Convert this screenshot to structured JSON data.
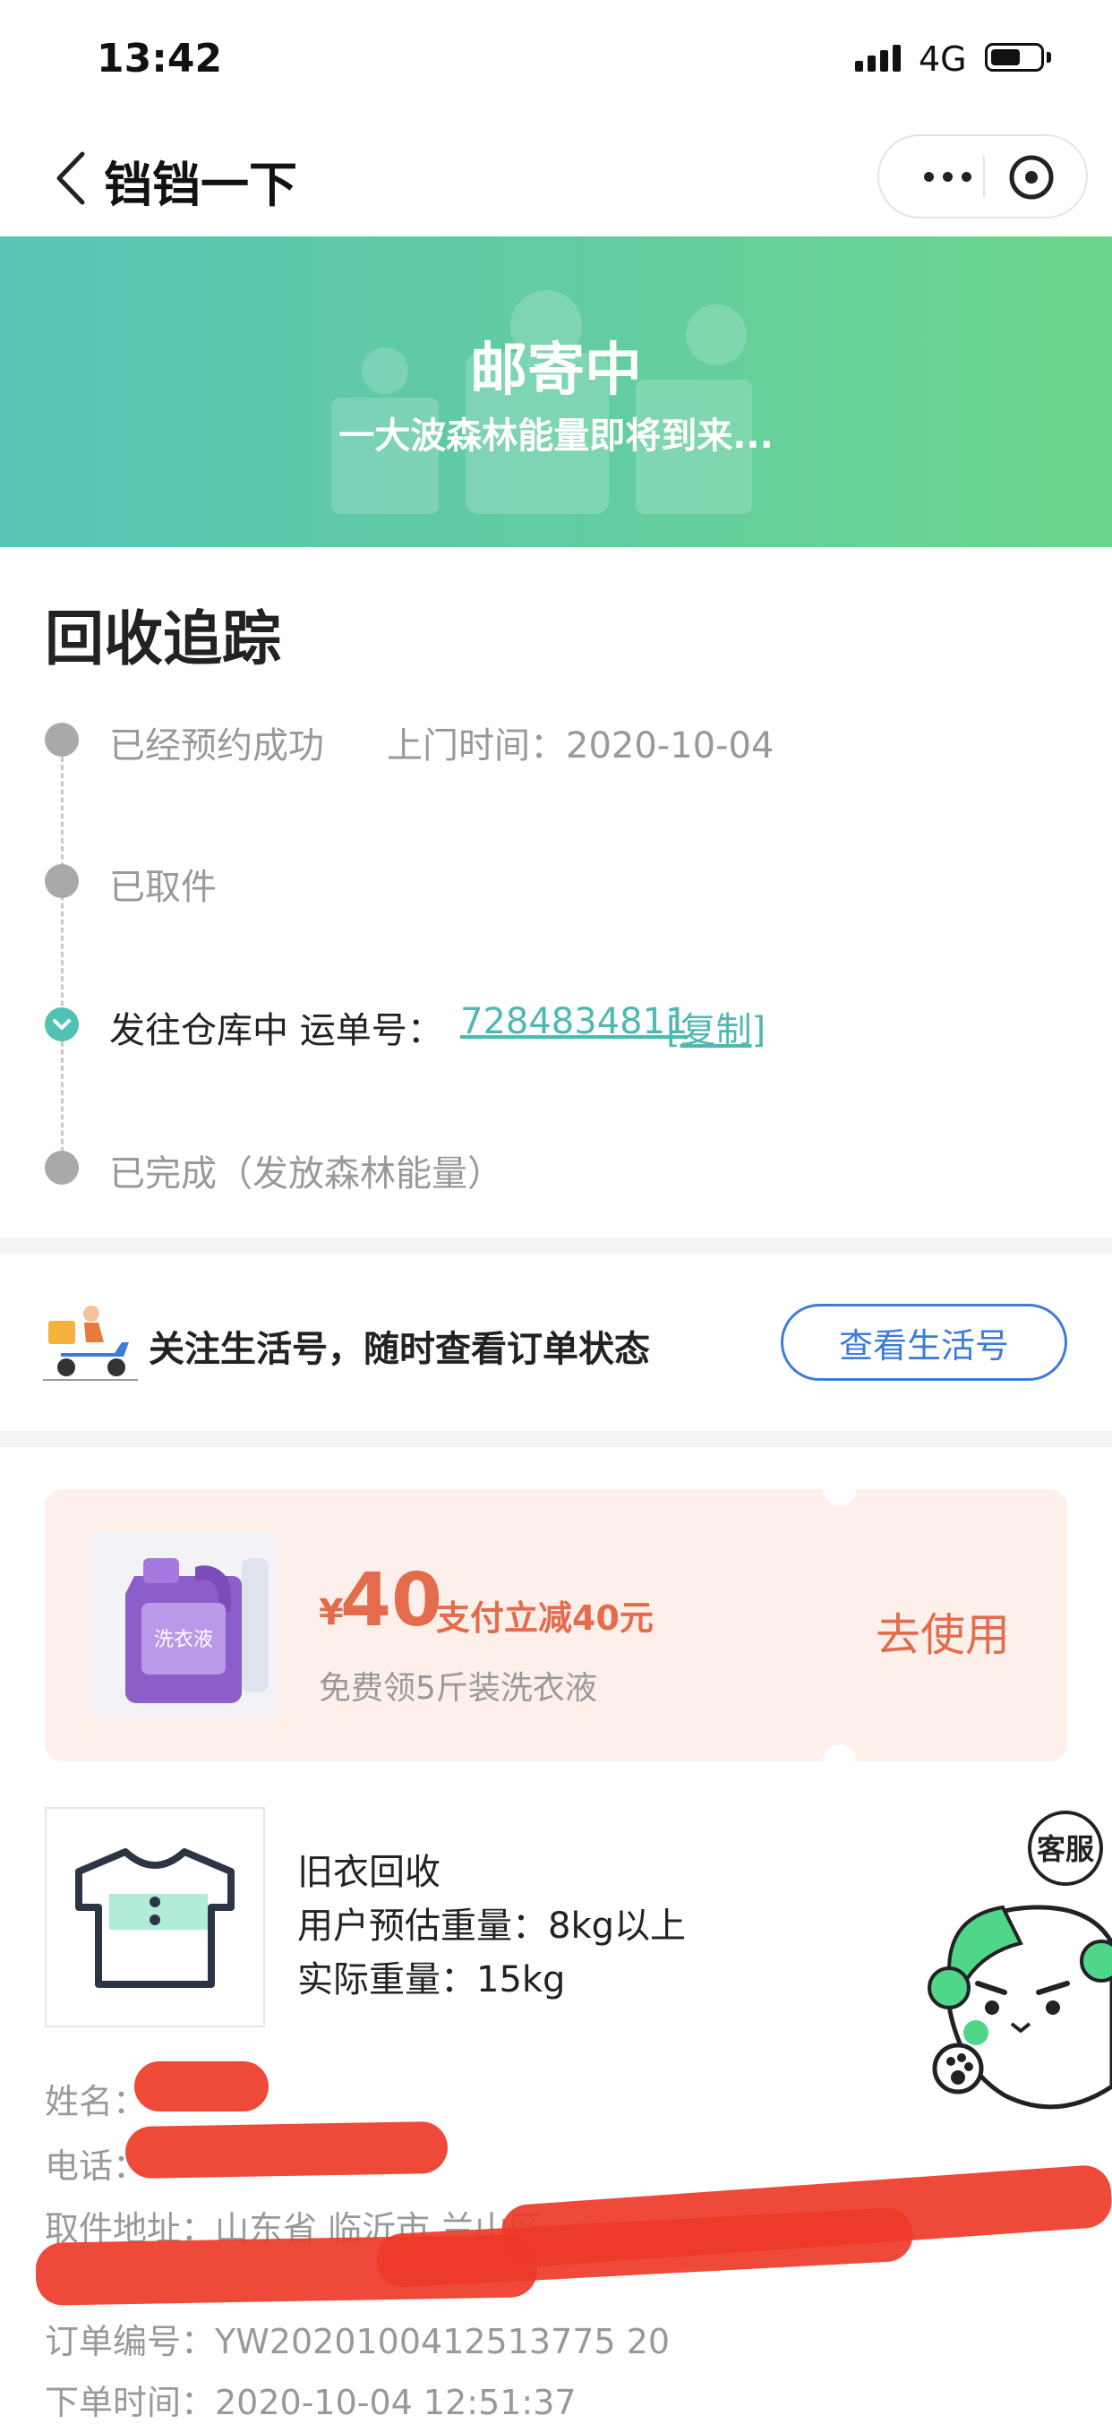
{
  "status_bar": {
    "time": "13:42",
    "network": "4G"
  },
  "nav": {
    "title": "铛铛一下"
  },
  "banner": {
    "title": "邮寄中",
    "subtitle": "一大波森林能量即将到来..."
  },
  "tracking": {
    "title": "回收追踪",
    "steps": [
      {
        "label": "已经预约成功",
        "extra": "上门时间：2020-10-04",
        "state": "done"
      },
      {
        "label": "已取件",
        "state": "done"
      },
      {
        "label": "发往仓库中 运单号：",
        "tracking_number": "7284834811",
        "copy_label": "[复制]",
        "state": "current"
      },
      {
        "label": "已完成（发放森林能量）",
        "state": "pending"
      }
    ]
  },
  "follow": {
    "text": "关注生活号，随时查看订单状态",
    "button": "查看生活号"
  },
  "coupon": {
    "currency": "¥",
    "amount": "40",
    "description": "支付立减40元",
    "subtitle": "免费领5斤装洗衣液",
    "action": "去使用",
    "product_label": "洗衣液"
  },
  "product": {
    "name": "旧衣回收",
    "estimated_weight": "用户预估重量：8kg以上",
    "actual_weight": "实际重量：15kg"
  },
  "order_info": {
    "name_label": "姓名：",
    "phone_label": "电话：",
    "address": "取件地址：山东省 临沂市 兰山区",
    "order_number": "订单编号：YW2020100412513775 20",
    "order_time": "下单时间：2020-10-04 12:51:37"
  },
  "mascot": {
    "service_label": "客服"
  },
  "colors": {
    "accent_teal": "#4fc2b4",
    "banner_start": "#5ac4b6",
    "banner_end": "#6ad68c",
    "link_blue": "#3d7bd9",
    "coupon_orange": "#e46b4b",
    "coupon_bg": "#fdf0eb"
  }
}
